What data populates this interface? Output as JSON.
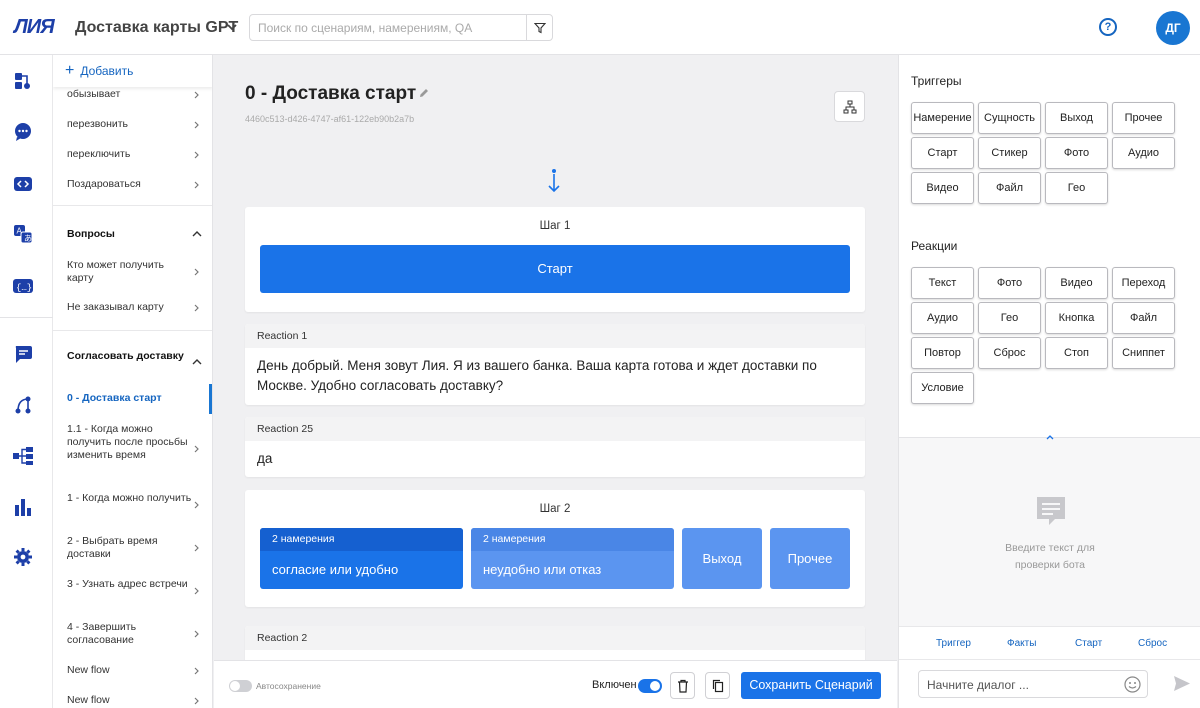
{
  "header": {
    "logo": "ЛИЯ",
    "project_title": "Доставка карты GPT",
    "search_placeholder": "Поиск по сценариям, намерениям, QA",
    "avatar_initials": "ДГ",
    "help_label": "?"
  },
  "rail_icons": [
    "scenarios-icon",
    "chat-bubbles-icon",
    "code-icon",
    "translate-icon",
    "variables-icon",
    "dialogs-icon",
    "flows-icon",
    "hierarchy-icon",
    "analytics-icon",
    "settings-icon"
  ],
  "sidebar": {
    "add_label": "Добавить",
    "items_top": [
      {
        "label": "обызывает"
      },
      {
        "label": "перезвонить"
      },
      {
        "label": "переключить"
      },
      {
        "label": "Поздароваться"
      }
    ],
    "group_questions": {
      "title": "Вопросы",
      "items": [
        {
          "label": "Кто может получить карту"
        },
        {
          "label": "Не заказывал карту"
        }
      ]
    },
    "group_agree": {
      "title": "Согласовать доставку",
      "items": [
        {
          "label": "0 - Доставка старт"
        },
        {
          "label": "1.1 - Когда можно получить после просьбы изменить время"
        },
        {
          "label": "1 - Когда можно получить"
        },
        {
          "label": "2 - Выбрать время доставки"
        },
        {
          "label": "3 - Узнать адрес встречи"
        },
        {
          "label": "4 - Завершить согласование"
        },
        {
          "label": "New flow"
        },
        {
          "label": "New flow"
        }
      ]
    }
  },
  "scenario": {
    "title": "0 - Доставка старт",
    "id": "4460c513-d426-4747-af61-122eb90b2a7b",
    "step1": {
      "label": "Шаг 1",
      "start_label": "Старт"
    },
    "reaction1": {
      "title": "Reaction 1",
      "text": "День добрый. Меня зовут Лия. Я из вашего банка. Ваша карта готова и ждет доставки по Москве. Удобно согласовать доставку?"
    },
    "reaction25": {
      "title": "Reaction 25",
      "text": "да"
    },
    "step2": {
      "label": "Шаг 2",
      "intent1": {
        "count": "2 намерения",
        "name": "согласие или удобно"
      },
      "intent2": {
        "count": "2 намерения",
        "name": "неудобно или отказ"
      },
      "exit_label": "Выход",
      "other_label": "Прочее"
    },
    "reaction2": {
      "title": "Reaction 2"
    }
  },
  "bottombar": {
    "autosave_label": "Автосохранение",
    "enabled_label": "Включен",
    "save_label": "Сохранить Сценарий"
  },
  "right_panel": {
    "triggers_title": "Триггеры",
    "triggers": [
      "Намерение",
      "Сущность",
      "Выход",
      "Прочее",
      "Старт",
      "Стикер",
      "Фото",
      "Аудио",
      "Видео",
      "Файл",
      "Гео"
    ],
    "reactions_title": "Реакции",
    "reactions": [
      "Текст",
      "Фото",
      "Видео",
      "Переход",
      "Аудио",
      "Гео",
      "Кнопка",
      "Файл",
      "Повтор",
      "Сброс",
      "Стоп",
      "Сниппет",
      "Условие"
    ],
    "test_hint_line1": "Введите текст для",
    "test_hint_line2": "проверки бота",
    "tabs": [
      "Триггер",
      "Факты",
      "Старт",
      "Сброс"
    ],
    "dialog_placeholder": "Начните диалог ..."
  },
  "colors": {
    "accent": "#1a73e8",
    "intent_dark": "#1565e0",
    "intent_light": "#5b95f0"
  }
}
